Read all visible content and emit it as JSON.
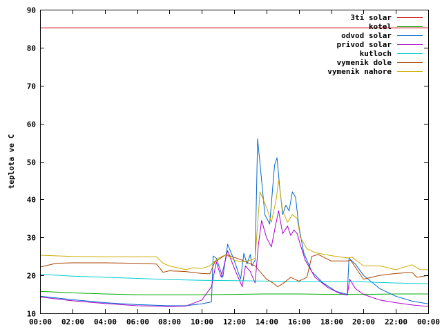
{
  "chart_data": {
    "type": "line",
    "title": "",
    "xlabel": "",
    "ylabel": "teplota ve C",
    "xlim": [
      0,
      24
    ],
    "ylim": [
      10,
      90
    ],
    "x_ticks": [
      0,
      2,
      4,
      6,
      8,
      10,
      12,
      14,
      16,
      18,
      20,
      22,
      24
    ],
    "x_tick_labels": [
      "00:00",
      "02:00",
      "04:00",
      "06:00",
      "08:00",
      "10:00",
      "12:00",
      "14:00",
      "16:00",
      "18:00",
      "20:00",
      "22:00",
      "00:00"
    ],
    "y_ticks": [
      10,
      20,
      30,
      40,
      50,
      60,
      70,
      80,
      90
    ],
    "y_tick_labels": [
      "10",
      "20",
      "30",
      "40",
      "50",
      "60",
      "70",
      "80",
      "90"
    ],
    "grid": false,
    "legend_position": "top-right",
    "series": [
      {
        "name": "3ti solar",
        "color": "#cc0000",
        "points": [
          [
            0,
            85.2
          ],
          [
            24,
            85.2
          ]
        ]
      },
      {
        "name": "kotel",
        "color": "#00aa00",
        "points": [
          [
            0,
            15.8
          ],
          [
            2,
            15.4
          ],
          [
            4,
            15.1
          ],
          [
            6,
            14.9
          ],
          [
            8,
            14.9
          ],
          [
            10,
            14.9
          ],
          [
            12,
            15.0
          ],
          [
            14,
            15.1
          ],
          [
            16,
            15.1
          ],
          [
            18,
            15.0
          ],
          [
            20,
            15.0
          ],
          [
            22,
            15.1
          ],
          [
            24,
            15.1
          ]
        ]
      },
      {
        "name": "odvod solar",
        "color": "#0066cc",
        "points": [
          [
            0,
            14.5
          ],
          [
            2,
            13.6
          ],
          [
            4,
            12.8
          ],
          [
            6,
            12.3
          ],
          [
            8,
            12.0
          ],
          [
            9,
            12.0
          ],
          [
            10,
            12.5
          ],
          [
            10.6,
            13.0
          ],
          [
            10.7,
            25.1
          ],
          [
            10.9,
            24.5
          ],
          [
            11.3,
            19.5
          ],
          [
            11.6,
            28.2
          ],
          [
            12.0,
            24.0
          ],
          [
            12.4,
            19.0
          ],
          [
            12.6,
            25.8
          ],
          [
            12.8,
            23.0
          ],
          [
            13.0,
            25.5
          ],
          [
            13.1,
            22.5
          ],
          [
            13.3,
            24.0
          ],
          [
            13.45,
            56.0
          ],
          [
            13.7,
            45.0
          ],
          [
            13.9,
            36.0
          ],
          [
            14.2,
            33.5
          ],
          [
            14.5,
            49.0
          ],
          [
            14.65,
            51.0
          ],
          [
            14.8,
            44.0
          ],
          [
            15.0,
            36.0
          ],
          [
            15.2,
            38.5
          ],
          [
            15.4,
            37.0
          ],
          [
            15.6,
            42.0
          ],
          [
            15.8,
            40.5
          ],
          [
            16.0,
            33.0
          ],
          [
            16.3,
            26.0
          ],
          [
            16.8,
            21.0
          ],
          [
            17.5,
            18.0
          ],
          [
            18.3,
            15.8
          ],
          [
            19.0,
            15.0
          ],
          [
            19.1,
            24.5
          ],
          [
            19.5,
            23.0
          ],
          [
            20.0,
            20.0
          ],
          [
            21.0,
            16.5
          ],
          [
            22.0,
            14.5
          ],
          [
            23.0,
            13.2
          ],
          [
            24.0,
            12.5
          ]
        ]
      },
      {
        "name": "privod solar",
        "color": "#aa00cc",
        "points": [
          [
            0,
            14.3
          ],
          [
            2,
            13.3
          ],
          [
            4,
            12.6
          ],
          [
            6,
            12.0
          ],
          [
            8,
            11.8
          ],
          [
            9,
            11.9
          ],
          [
            10,
            13.5
          ],
          [
            10.6,
            17.0
          ],
          [
            10.9,
            23.5
          ],
          [
            11.2,
            19.5
          ],
          [
            11.6,
            26.5
          ],
          [
            12.0,
            22.0
          ],
          [
            12.5,
            17.0
          ],
          [
            12.7,
            22.5
          ],
          [
            13.0,
            21.0
          ],
          [
            13.3,
            18.0
          ],
          [
            13.5,
            28.0
          ],
          [
            13.7,
            34.5
          ],
          [
            14.0,
            30.0
          ],
          [
            14.3,
            27.5
          ],
          [
            14.6,
            34.0
          ],
          [
            14.75,
            37.0
          ],
          [
            15.0,
            31.0
          ],
          [
            15.3,
            33.0
          ],
          [
            15.5,
            30.5
          ],
          [
            15.7,
            32.0
          ],
          [
            15.9,
            31.0
          ],
          [
            16.1,
            28.0
          ],
          [
            16.4,
            24.0
          ],
          [
            17.0,
            19.5
          ],
          [
            17.8,
            16.8
          ],
          [
            18.5,
            15.3
          ],
          [
            19.0,
            14.8
          ],
          [
            19.15,
            19.0
          ],
          [
            19.5,
            16.5
          ],
          [
            20.0,
            15.0
          ],
          [
            21.0,
            13.5
          ],
          [
            22.0,
            12.8
          ],
          [
            23.0,
            12.2
          ],
          [
            24.0,
            11.8
          ]
        ]
      },
      {
        "name": "kutloch",
        "color": "#00cccc",
        "points": [
          [
            0,
            20.3
          ],
          [
            2,
            19.8
          ],
          [
            4,
            19.5
          ],
          [
            6,
            19.2
          ],
          [
            8,
            18.9
          ],
          [
            10,
            18.7
          ],
          [
            12,
            18.6
          ],
          [
            14,
            18.5
          ],
          [
            16,
            18.4
          ],
          [
            18,
            18.3
          ],
          [
            20,
            18.3
          ],
          [
            22,
            18.0
          ],
          [
            24,
            17.8
          ]
        ]
      },
      {
        "name": "vymenik dole",
        "color": "#aa4400",
        "points": [
          [
            0,
            22.2
          ],
          [
            1,
            23.2
          ],
          [
            2,
            23.3
          ],
          [
            4,
            23.3
          ],
          [
            6,
            23.2
          ],
          [
            7.2,
            23.0
          ],
          [
            7.6,
            20.8
          ],
          [
            8,
            21.2
          ],
          [
            9,
            21.0
          ],
          [
            10,
            20.5
          ],
          [
            10.5,
            20.4
          ],
          [
            10.8,
            23.5
          ],
          [
            11.5,
            25.5
          ],
          [
            12.5,
            24.0
          ],
          [
            13.3,
            22.5
          ],
          [
            13.6,
            21.0
          ],
          [
            14.0,
            19.0
          ],
          [
            14.4,
            18.0
          ],
          [
            14.7,
            17.0
          ],
          [
            15.0,
            17.8
          ],
          [
            15.5,
            19.5
          ],
          [
            16.0,
            18.5
          ],
          [
            16.5,
            19.5
          ],
          [
            16.8,
            25.0
          ],
          [
            17.2,
            25.5
          ],
          [
            18.0,
            23.8
          ],
          [
            19.0,
            23.8
          ],
          [
            19.2,
            24.0
          ],
          [
            19.6,
            21.5
          ],
          [
            20.0,
            19.0
          ],
          [
            21.0,
            20.0
          ],
          [
            22.0,
            20.5
          ],
          [
            23.0,
            20.8
          ],
          [
            23.3,
            19.5
          ],
          [
            24.0,
            20.0
          ]
        ]
      },
      {
        "name": "vymenik nahore",
        "color": "#ccaa00",
        "points": [
          [
            0,
            25.3
          ],
          [
            2,
            25.0
          ],
          [
            4,
            24.9
          ],
          [
            6,
            24.9
          ],
          [
            7.2,
            24.9
          ],
          [
            7.6,
            23.2
          ],
          [
            8,
            22.5
          ],
          [
            9,
            21.5
          ],
          [
            9.5,
            22.0
          ],
          [
            10,
            21.8
          ],
          [
            10.5,
            22.5
          ],
          [
            11.0,
            24.5
          ],
          [
            11.5,
            25.5
          ],
          [
            12.0,
            24.0
          ],
          [
            12.5,
            23.5
          ],
          [
            13.0,
            24.0
          ],
          [
            13.3,
            24.5
          ],
          [
            13.6,
            42.0
          ],
          [
            14.0,
            38.0
          ],
          [
            14.3,
            34.0
          ],
          [
            14.6,
            40.0
          ],
          [
            14.75,
            45.0
          ],
          [
            15.0,
            37.0
          ],
          [
            15.3,
            34.0
          ],
          [
            15.6,
            36.0
          ],
          [
            15.9,
            35.0
          ],
          [
            16.1,
            30.0
          ],
          [
            16.5,
            27.0
          ],
          [
            17.0,
            26.0
          ],
          [
            18.0,
            25.2
          ],
          [
            19.0,
            24.6
          ],
          [
            19.3,
            24.8
          ],
          [
            20.0,
            22.5
          ],
          [
            21.0,
            22.5
          ],
          [
            22.0,
            21.5
          ],
          [
            23.0,
            22.8
          ],
          [
            23.5,
            21.5
          ],
          [
            24.0,
            21.5
          ]
        ]
      }
    ]
  }
}
